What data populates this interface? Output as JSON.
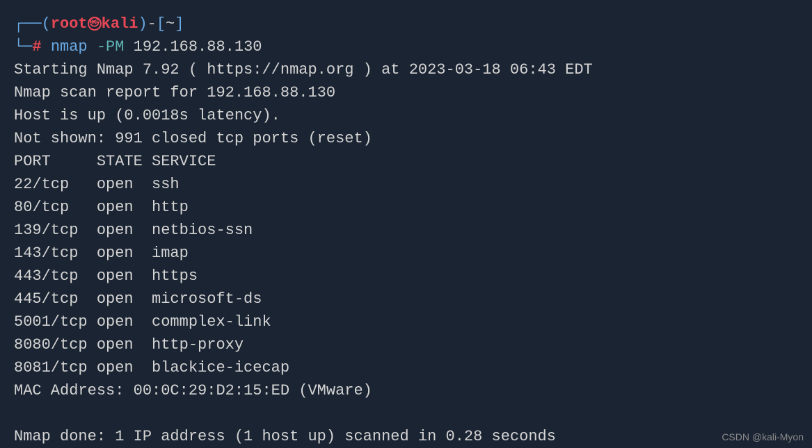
{
  "prompt": {
    "branch1": "┌──",
    "paren_open": "(",
    "user": "root",
    "at_symbol": "㉿",
    "host": "kali",
    "paren_close": ")",
    "dash": "-",
    "bracket_open": "[",
    "cwd": "~",
    "bracket_close": "]",
    "branch2": "└─",
    "hash": "#",
    "command": "nmap",
    "flag": "-PM",
    "target": "192.168.88.130"
  },
  "output": {
    "line1": "Starting Nmap 7.92 ( https://nmap.org ) at 2023-03-18 06:43 EDT",
    "line2": "Nmap scan report for 192.168.88.130",
    "line3": "Host is up (0.0018s latency).",
    "line4": "Not shown: 991 closed tcp ports (reset)",
    "header": "PORT     STATE SERVICE",
    "ports": [
      {
        "port": "22/tcp   open  ssh"
      },
      {
        "port": "80/tcp   open  http"
      },
      {
        "port": "139/tcp  open  netbios-ssn"
      },
      {
        "port": "143/tcp  open  imap"
      },
      {
        "port": "443/tcp  open  https"
      },
      {
        "port": "445/tcp  open  microsoft-ds"
      },
      {
        "port": "5001/tcp open  commplex-link"
      },
      {
        "port": "8080/tcp open  http-proxy"
      },
      {
        "port": "8081/tcp open  blackice-icecap"
      }
    ],
    "mac": "MAC Address: 00:0C:29:D2:15:ED (VMware)",
    "blank": "",
    "done": "Nmap done: 1 IP address (1 host up) scanned in 0.28 seconds"
  },
  "watermark": "CSDN @kali-Myon"
}
